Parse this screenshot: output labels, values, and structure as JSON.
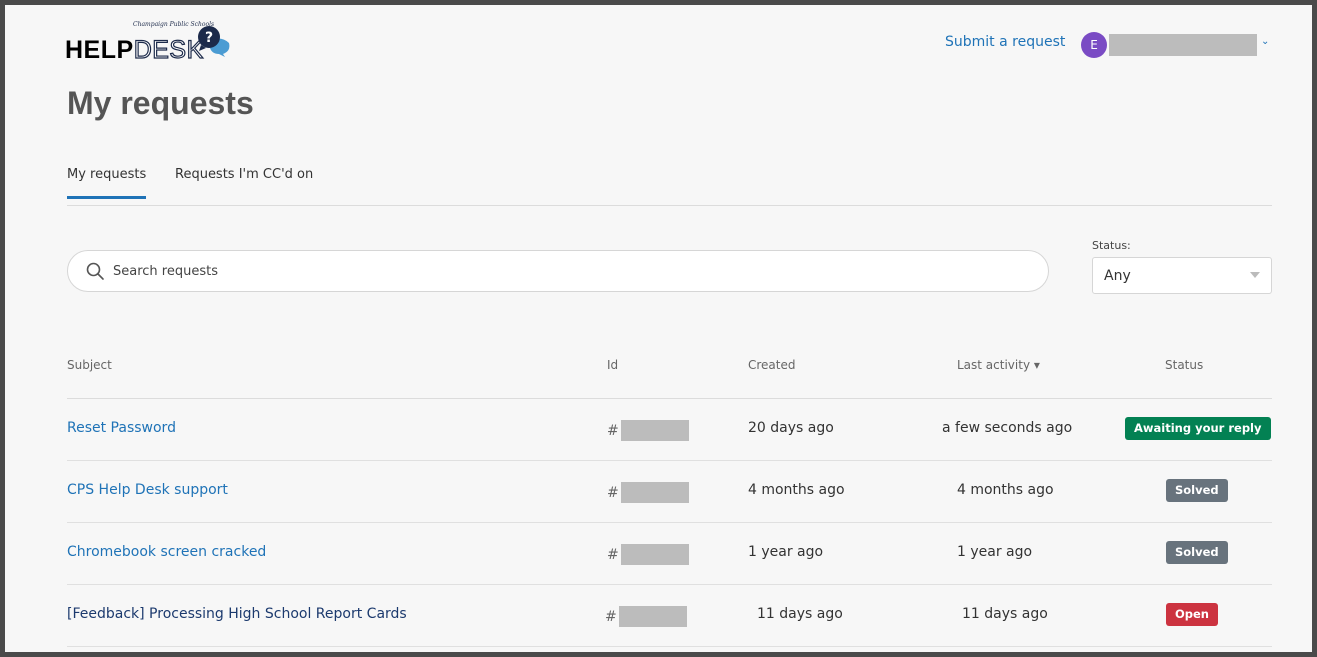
{
  "header": {
    "logo_help": "HELP",
    "logo_desk": "DESK",
    "logo_script": "Champaign Public Schools",
    "logo_bubble_glyph": "?",
    "submit_request": "Submit a request",
    "user_initial": "E",
    "user_menu_icon": "chevron-down-icon"
  },
  "page": {
    "title": "My requests"
  },
  "tabs": [
    {
      "label": "My requests",
      "active": true
    },
    {
      "label": "Requests I'm CC'd on",
      "active": false
    }
  ],
  "search": {
    "placeholder": "Search requests",
    "icon": "search-icon"
  },
  "status_filter": {
    "label": "Status:",
    "selected": "Any"
  },
  "table": {
    "columns": {
      "subject": "Subject",
      "id": "Id",
      "created": "Created",
      "last_activity": "Last activity ▾",
      "status": "Status"
    },
    "rows": [
      {
        "subject": "Reset Password",
        "id_prefix": "#",
        "created": "20 days ago",
        "last_activity": "a few seconds ago",
        "status": "Awaiting your reply",
        "status_color": "#038153"
      },
      {
        "subject": "CPS Help Desk support",
        "id_prefix": "#",
        "created": "4 months ago",
        "last_activity": "4 months ago",
        "status": "Solved",
        "status_color": "#68737d"
      },
      {
        "subject": "Chromebook screen cracked",
        "id_prefix": "#",
        "created": "1 year ago",
        "last_activity": "1 year ago",
        "status": "Solved",
        "status_color": "#68737d"
      },
      {
        "subject": "[Feedback] Processing High School Report Cards",
        "id_prefix": "#",
        "created": "11 days ago",
        "last_activity": "11 days ago",
        "status": "Open",
        "status_color": "#cc3340"
      }
    ]
  },
  "colors": {
    "link": "#1f73b7",
    "avatar": "#7a4bc4",
    "background": "#f7f7f7"
  }
}
